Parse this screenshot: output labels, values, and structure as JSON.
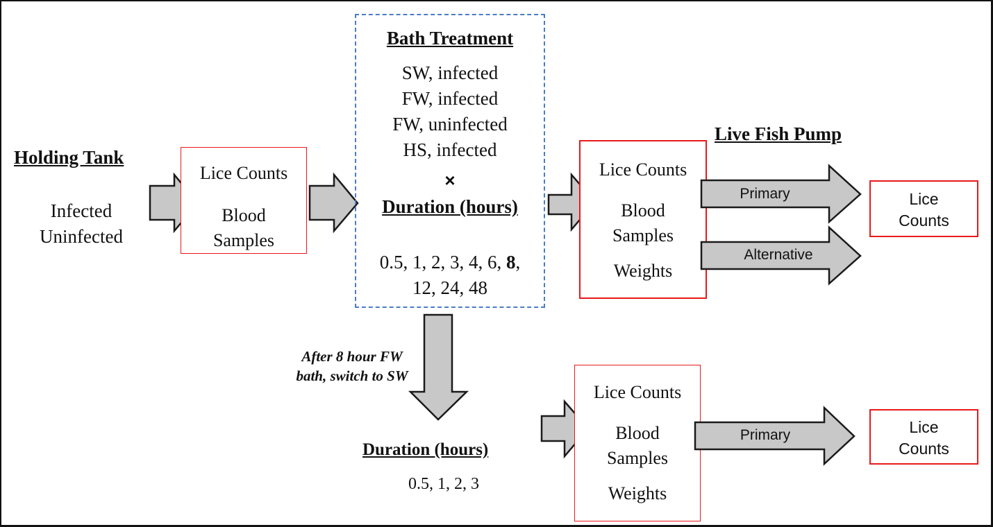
{
  "holding_tank": {
    "title": "Holding Tank",
    "groups": [
      "Infected",
      "Uninfected"
    ]
  },
  "stage1_box": {
    "items": [
      "Lice Counts",
      "Blood",
      "Samples"
    ]
  },
  "bath_treatment": {
    "title": "Bath Treatment",
    "conditions": [
      "SW, infected",
      "FW, infected",
      "FW, uninfected",
      "HS, infected"
    ],
    "times_symbol": "×",
    "duration_title": "Duration (hours)",
    "durations_line1_prefix": "0.5, 1, 2, 3, 4, 6, ",
    "durations_line1_bold": "8",
    "durations_line1_suffix": ",",
    "durations_line2": "12, 24, 48"
  },
  "live_fish_pump": {
    "title": "Live Fish Pump"
  },
  "stage2_box": {
    "items": [
      "Lice Counts",
      "Blood",
      "Samples",
      "Weights"
    ]
  },
  "arrows": {
    "primary_label": "Primary",
    "alternative_label": "Alternative",
    "switch_note_line1": "After 8 hour FW",
    "switch_note_line2": "bath, switch to SW"
  },
  "stage2_end_box": {
    "items": [
      "Lice",
      "Counts"
    ]
  },
  "recovery": {
    "duration_title": "Duration (hours)",
    "durations": "0.5, 1, 2, 3"
  },
  "stage3_box": {
    "items": [
      "Lice Counts",
      "Blood",
      "Samples",
      "Weights"
    ]
  },
  "stage3_end_box": {
    "items": [
      "Lice",
      "Counts"
    ]
  },
  "colors": {
    "box_border": "#e8191a",
    "dashed_border": "#4a7cc4",
    "arrow_fill": "#c8c8c8",
    "arrow_stroke": "#1a1a1a"
  }
}
